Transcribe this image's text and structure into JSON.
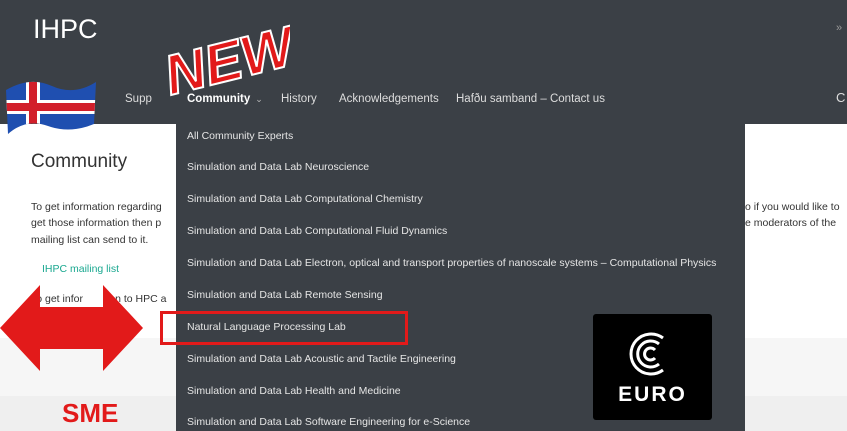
{
  "site": {
    "title": "IHPC"
  },
  "nav": {
    "items": [
      {
        "label": "Supp",
        "active": false
      },
      {
        "label": "Community",
        "active": true
      },
      {
        "label": "History",
        "active": false
      },
      {
        "label": "Acknowledgements",
        "active": false
      },
      {
        "label": "Hafðu samband – Contact us",
        "active": false
      }
    ],
    "caret": "⌄",
    "search_glyph": "C"
  },
  "page": {
    "title": "Community",
    "lines": [
      "To get information regarding",
      "get those information then p",
      "mailing list can send to it."
    ],
    "right_lines": [
      "o if you would like to",
      "e moderators of the"
    ],
    "link": "IHPC mailing list",
    "line4": "To get infor",
    "line4b": "tion to HPC a"
  },
  "dropdown": {
    "items": [
      "All Community Experts",
      "Simulation and Data Lab Neuroscience",
      "Simulation and Data Lab Computational Chemistry",
      "Simulation and Data Lab Computational Fluid Dynamics",
      "Simulation and Data Lab Electron, optical and transport properties of nanoscale systems – Computational Physics",
      "Simulation and Data Lab Remote Sensing",
      "Natural Language Processing Lab",
      "Simulation and Data Lab Acoustic and Tactile Engineering",
      "Simulation and Data Lab Health and Medicine",
      "Simulation and Data Lab Software Engineering for e-Science"
    ]
  },
  "overlays": {
    "new_badge": "NEW",
    "euro_logo": "EURO",
    "sme": "SME"
  },
  "colors": {
    "header_bg": "#3b4046",
    "link": "#1aa890",
    "annotation_red": "#e21a1a"
  },
  "icons": [
    "rss-icon",
    "search-icon",
    "chevron-down-icon",
    "iceland-flag-icon",
    "double-arrow-icon",
    "euro-logo-icon"
  ]
}
